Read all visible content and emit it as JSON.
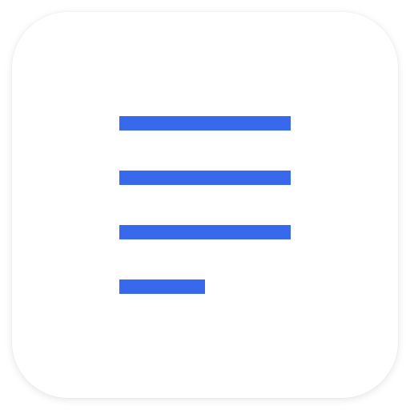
{
  "icon": {
    "name": "text-align-left-icon",
    "tile_color": "#ffffff",
    "accent_color": "#3869EC"
  }
}
